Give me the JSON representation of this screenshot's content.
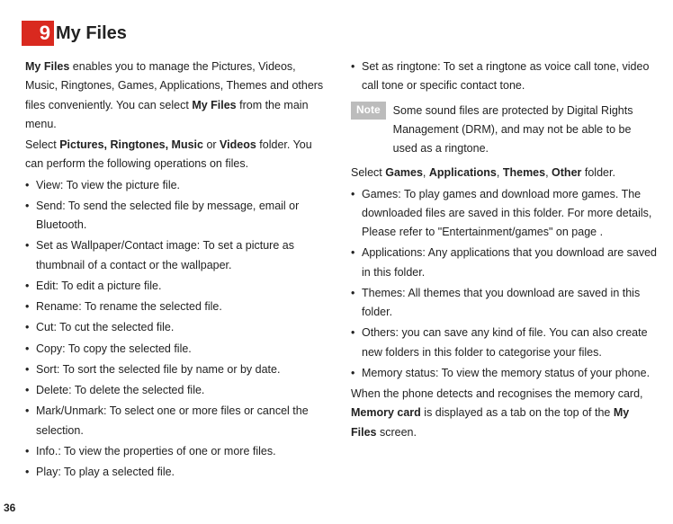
{
  "header": {
    "number": "9",
    "title": "My Files"
  },
  "intro": {
    "p1_a": "My Files",
    "p1_b": " enables you to manage the Pictures, Videos, Music, Ringtones, Games, Applications, Themes and others files conveniently. You can select ",
    "p1_c": "My Files",
    "p1_d": " from the main menu.",
    "p2_a": "Select  ",
    "p2_b": "Pictures, Ringtones, Music",
    "p2_c": " or ",
    "p2_d": "Videos",
    "p2_e": " folder. You can perform the following operations on files."
  },
  "ops": [
    "View: To view the picture file.",
    "Send: To send the selected file by message, email or Bluetooth.",
    "Set as Wallpaper/Contact image: To set a picture as thumbnail of a contact or the wallpaper.",
    "Edit: To edit a picture file.",
    "Rename: To rename the selected file.",
    "Cut: To cut the selected file.",
    "Copy: To copy the selected file.",
    "Sort: To sort the selected file by name or by date.",
    "Delete: To delete the selected file.",
    "Mark/Unmark: To select one or more files or cancel the selection.",
    "Info.: To view the properties of one or more files.",
    "Play: To play a selected file.",
    "Set as ringtone: To set a ringtone as voice call tone, video call tone or specific contact tone."
  ],
  "note": {
    "label": "Note",
    "text": "Some sound files are protected by Digital Rights Management (DRM), and may not be able to be used as a ringtone."
  },
  "select2": {
    "a": "Select  ",
    "b": "Games",
    "c": ", ",
    "d": "Applications",
    "e": ", ",
    "f": "Themes",
    "g": ", ",
    "h": "Other",
    "i": " folder."
  },
  "folders": [
    "Games: To play games and download more games. The downloaded files are saved in this folder. For more details, Please refer to \"Entertainment/games\" on page .",
    "Applications: Any applications that you download are saved in this folder.",
    "Themes: All themes that you download are saved in this folder.",
    "Others: you can save any kind of file. You can also create new folders in this folder to categorise your files.",
    "Memory status: To view the memory status of your phone."
  ],
  "closing": {
    "a": "When the phone detects and recognises the memory card, ",
    "b": "Memory card",
    "c": " is displayed as a tab on the top of the ",
    "d": "My Files",
    "e": " screen."
  },
  "pagenum": "36"
}
